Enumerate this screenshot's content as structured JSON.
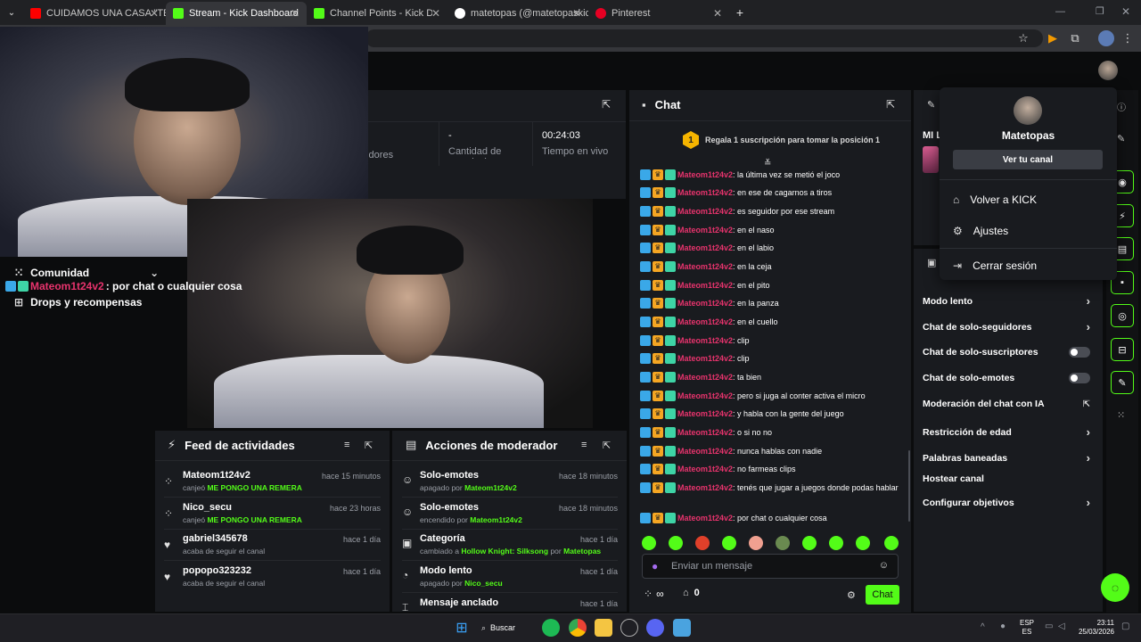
{
  "browser": {
    "tabs": [
      {
        "title": "CUIDAMOS UNA CASA \"TERMI",
        "icon": "youtube-icon",
        "color": "#ff0000"
      },
      {
        "title": "Stream - Kick Dashboard",
        "icon": "kick-icon",
        "color": "#53fc18"
      },
      {
        "title": "Channel Points - Kick Dashboar",
        "icon": "kick-icon",
        "color": "#53fc18"
      },
      {
        "title": "matetopas (@matetopaskick) |",
        "icon": "tiktok-icon",
        "color": "#ffffff"
      },
      {
        "title": "Pinterest",
        "icon": "pinterest-icon",
        "color": "#e60023"
      }
    ],
    "new_tab": "+"
  },
  "overlay": {
    "community_label": "Comunidad",
    "last_chat_user": "Mateom1t24v2",
    "last_chat_text": ": por chat o cualquier cosa",
    "drops_label": "Drops y recompensas"
  },
  "stats": {
    "followers_label": "uidores",
    "subs_value": "-",
    "subs_label": "Cantidad de suscripciones",
    "live_time_value": "00:24:03",
    "live_time_label": "Tiempo en vivo"
  },
  "chat": {
    "title": "Chat",
    "gift_rank": "1",
    "gift_text": "Regala 1 suscripción para tomar la posición 1",
    "messages": [
      {
        "user": "Mateom1t24v2",
        "text": ": la última vez se metió el joco"
      },
      {
        "user": "Mateom1t24v2",
        "text": ": en ese de cagarnos a tiros"
      },
      {
        "user": "Mateom1t24v2",
        "text": ": es seguidor por ese stream"
      },
      {
        "user": "Mateom1t24v2",
        "text": ": en el naso"
      },
      {
        "user": "Mateom1t24v2",
        "text": ": en el labio"
      },
      {
        "user": "Mateom1t24v2",
        "text": ": en la ceja"
      },
      {
        "user": "Mateom1t24v2",
        "text": ": en el pito"
      },
      {
        "user": "Mateom1t24v2",
        "text": ": en la panza"
      },
      {
        "user": "Mateom1t24v2",
        "text": ": en el cuello"
      },
      {
        "user": "Mateom1t24v2",
        "text": ": clip"
      },
      {
        "user": "Mateom1t24v2",
        "text": ": clip"
      },
      {
        "user": "Mateom1t24v2",
        "text": ": ta bien"
      },
      {
        "user": "Mateom1t24v2",
        "text": ": pero si juga al conter activa el micro"
      },
      {
        "user": "Mateom1t24v2",
        "text": ": y habla con la gente del juego"
      },
      {
        "user": "Mateom1t24v2",
        "text": ": o si no no"
      },
      {
        "user": "Mateom1t24v2",
        "text": ": nunca hablas con nadie"
      },
      {
        "user": "Mateom1t24v2",
        "text": ": no farmeas clips"
      },
      {
        "user": "Mateom1t24v2",
        "text": ": tenés que jugar a juegos donde podas hablar"
      },
      {
        "user": "Mateom1t24v2",
        "text": ": por chat o cualquier cosa"
      }
    ],
    "input_placeholder": "Enviar un mensaje",
    "viewers_symbol": "∞",
    "points_count": "0",
    "send_label": "Chat"
  },
  "activity_feed": {
    "title": "Feed de actividades",
    "items": [
      {
        "user": "Mateom1t24v2",
        "action": "canjeó",
        "reward": "ME PONGO UNA REMERA",
        "time": "hace 15 minutos",
        "icon": "points-icon"
      },
      {
        "user": "Nico_secu",
        "action": "canjeó",
        "reward": "ME PONGO UNA REMERA",
        "time": "hace 23 horas",
        "icon": "points-icon"
      },
      {
        "user": "gabriel345678",
        "action": "acaba de seguir el canal",
        "reward": "",
        "time": "hace 1 día",
        "icon": "heart-icon"
      },
      {
        "user": "popopo323232",
        "action": "acaba de seguir el canal",
        "reward": "",
        "time": "hace 1 día",
        "icon": "heart-icon"
      }
    ]
  },
  "mod_actions": {
    "title": "Acciones de moderador",
    "items": [
      {
        "title": "Solo-emotes",
        "prefix": "apagado por",
        "highlight": "Mateom1t24v2",
        "suffix": "",
        "extra": "",
        "time": "hace 18 minutos"
      },
      {
        "title": "Solo-emotes",
        "prefix": "encendido por",
        "highlight": "Mateom1t24v2",
        "suffix": "",
        "extra": "",
        "time": "hace 18 minutos"
      },
      {
        "title": "Categoría",
        "prefix": "cambiado a",
        "highlight": "Hollow Knight: Silksong",
        "suffix": "por",
        "extra": "Matetopas",
        "time": "hace 1 día"
      },
      {
        "title": "Modo lento",
        "prefix": "apagado por",
        "highlight": "Nico_secu",
        "suffix": "",
        "extra": "",
        "time": "hace 1 día"
      },
      {
        "title": "Mensaje anclado",
        "prefix": "",
        "highlight": "",
        "suffix": "",
        "extra": "",
        "time": "hace 1 día"
      }
    ]
  },
  "profile_menu": {
    "username": "Matetopas",
    "view_channel": "Ver tu canal",
    "items": [
      "Volver a KICK",
      "Ajustes",
      "Cerrar sesión"
    ]
  },
  "side_panel": {
    "partial_title": "MI L",
    "settings": [
      {
        "label": "Modo lento",
        "control": "chevron"
      },
      {
        "label": "Chat de solo-seguidores",
        "control": "chevron"
      },
      {
        "label": "Chat de solo-suscriptores",
        "control": "toggle-off"
      },
      {
        "label": "Chat de solo-emotes",
        "control": "toggle-off"
      },
      {
        "label": "Moderación del chat con IA",
        "control": "external"
      },
      {
        "label": "Restricción de edad",
        "control": "chevron"
      },
      {
        "label": "Palabras baneadas",
        "control": "chevron"
      },
      {
        "label": "Hostear canal",
        "control": "none"
      },
      {
        "label": "Configurar objetivos",
        "control": "chevron"
      }
    ]
  },
  "taskbar": {
    "search_label": "Buscar",
    "lang_top": "ESP",
    "lang_bottom": "ES",
    "time": "23:11",
    "date": "25/03/2026"
  },
  "colors": {
    "accent": "#53fc18",
    "username": "#e8336d",
    "panel": "#191b1f"
  }
}
